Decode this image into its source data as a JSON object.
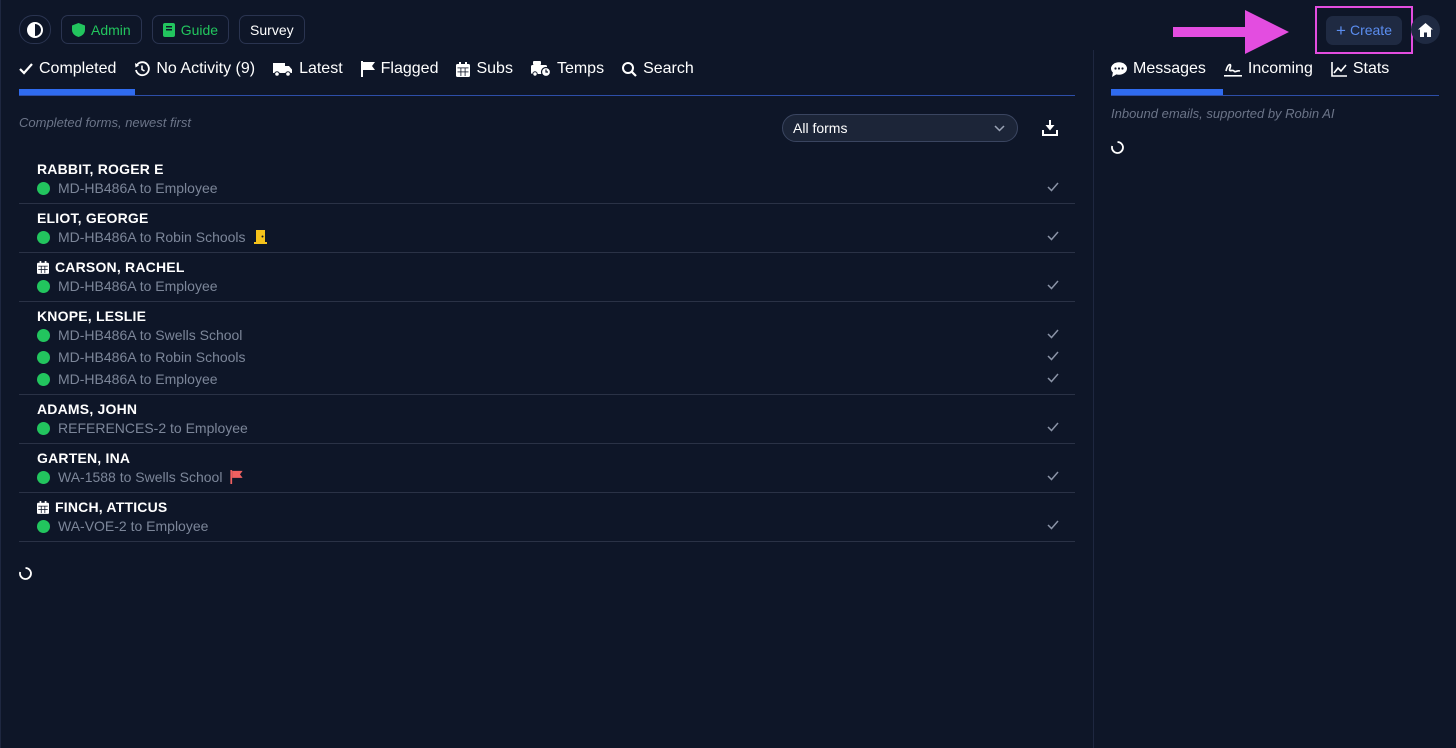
{
  "topbar": {
    "admin_label": "Admin",
    "guide_label": "Guide",
    "survey_label": "Survey",
    "create_label": "Create"
  },
  "left_tabs": [
    {
      "label": "Completed",
      "icon": "check-icon"
    },
    {
      "label": "No Activity (9)",
      "icon": "history-icon"
    },
    {
      "label": "Latest",
      "icon": "truck-icon"
    },
    {
      "label": "Flagged",
      "icon": "flag-icon"
    },
    {
      "label": "Subs",
      "icon": "calendar-icon"
    },
    {
      "label": "Temps",
      "icon": "truck-clock-icon"
    },
    {
      "label": "Search",
      "icon": "search-icon"
    }
  ],
  "left_subtitle": "Completed forms, newest first",
  "filter": {
    "selected": "All forms"
  },
  "groups": [
    {
      "name": "RABBIT, ROGER E",
      "calendar": false,
      "rows": [
        {
          "text": "MD-HB486A to Employee",
          "badge": ""
        }
      ]
    },
    {
      "name": "ELIOT, GEORGE",
      "calendar": false,
      "rows": [
        {
          "text": "MD-HB486A to Robin Schools",
          "badge": "door"
        }
      ]
    },
    {
      "name": "CARSON, RACHEL",
      "calendar": true,
      "rows": [
        {
          "text": "MD-HB486A to Employee",
          "badge": ""
        }
      ]
    },
    {
      "name": "KNOPE, LESLIE",
      "calendar": false,
      "rows": [
        {
          "text": "MD-HB486A to Swells School",
          "badge": ""
        },
        {
          "text": "MD-HB486A to Robin Schools",
          "badge": ""
        },
        {
          "text": "MD-HB486A to Employee",
          "badge": ""
        }
      ]
    },
    {
      "name": "ADAMS, JOHN",
      "calendar": false,
      "rows": [
        {
          "text": "REFERENCES-2 to Employee",
          "badge": ""
        }
      ]
    },
    {
      "name": "GARTEN, INA",
      "calendar": false,
      "rows": [
        {
          "text": "WA-1588 to Swells School",
          "badge": "flag"
        }
      ]
    },
    {
      "name": "FINCH, ATTICUS",
      "calendar": true,
      "rows": [
        {
          "text": "WA-VOE-2 to Employee",
          "badge": ""
        }
      ]
    }
  ],
  "right_tabs": [
    {
      "label": "Messages",
      "icon": "chat-icon"
    },
    {
      "label": "Incoming",
      "icon": "signature-icon"
    },
    {
      "label": "Stats",
      "icon": "chart-line-icon"
    }
  ],
  "right_subtitle": "Inbound emails, supported by Robin AI",
  "colors": {
    "background": "#0e1628",
    "accent": "#2f6bef",
    "status_green": "#22c55e",
    "highlight": "#e34de0"
  }
}
